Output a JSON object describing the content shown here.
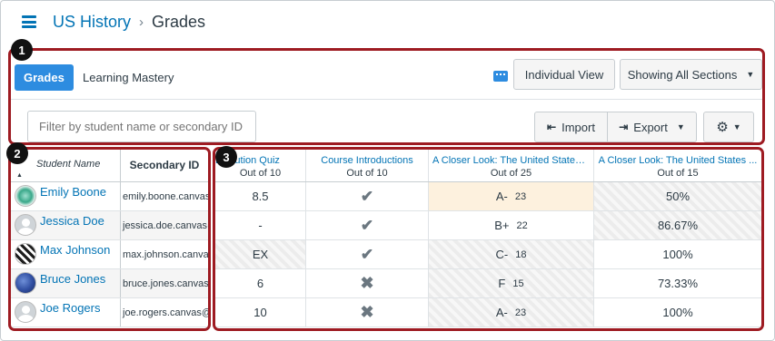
{
  "breadcrumb": {
    "course": "US History",
    "separator": "›",
    "page": "Grades"
  },
  "callouts": [
    "1",
    "2",
    "3"
  ],
  "tabs": {
    "grades": "Grades",
    "mastery": "Learning Mastery"
  },
  "toolbar": {
    "individual_view": "Individual View",
    "sections": "Showing All Sections",
    "caret": "▼",
    "filter_placeholder": "Filter by student name or secondary ID",
    "import": "Import",
    "export": "Export",
    "gear_caret": "▼"
  },
  "students": {
    "header_name": "Student Name",
    "header_id": "Secondary ID",
    "sort_glyph": "▲",
    "rows": [
      {
        "name": "Emily Boone",
        "id": "emily.boone.canvas@",
        "avatar": "green"
      },
      {
        "name": "Jessica Doe",
        "id": "jessica.doe.canvas@",
        "avatar": "default"
      },
      {
        "name": "Max Johnson",
        "id": "max.johnson.canvas",
        "avatar": "pattern"
      },
      {
        "name": "Bruce Jones",
        "id": "bruce.jones.canvas@",
        "avatar": "globe"
      },
      {
        "name": "Joe Rogers",
        "id": "joe.rogers.canvas@g",
        "avatar": "default"
      }
    ]
  },
  "assignments": [
    {
      "name": "Evolution Quiz",
      "points": "Out of 10"
    },
    {
      "name": "Course Introductions",
      "points": "Out of 10"
    },
    {
      "name": "A Closer Look: The United States ...",
      "points": "Out of 25"
    },
    {
      "name": "A Closer Look: The United States ...",
      "points": "Out of 15"
    }
  ],
  "grades": [
    {
      "quiz": "8.5",
      "intro": "check",
      "letter": "A-",
      "score": "23",
      "pct": "50%"
    },
    {
      "quiz": "-",
      "intro": "check",
      "letter": "B+",
      "score": "22",
      "pct": "86.67%"
    },
    {
      "quiz": "EX",
      "intro": "check",
      "letter": "C-",
      "score": "18",
      "pct": "100%"
    },
    {
      "quiz": "6",
      "intro": "cross",
      "letter": "F",
      "score": "15",
      "pct": "73.33%"
    },
    {
      "quiz": "10",
      "intro": "cross",
      "letter": "A-",
      "score": "23",
      "pct": "100%"
    }
  ],
  "icons": {
    "check": "✔",
    "cross": "✖",
    "import": "⇤",
    "export": "⇥",
    "gear": "⚙"
  },
  "colors": {
    "accent": "#0374b5",
    "tab_active": "#2d8ce0",
    "callout_border": "#9e1b22"
  }
}
